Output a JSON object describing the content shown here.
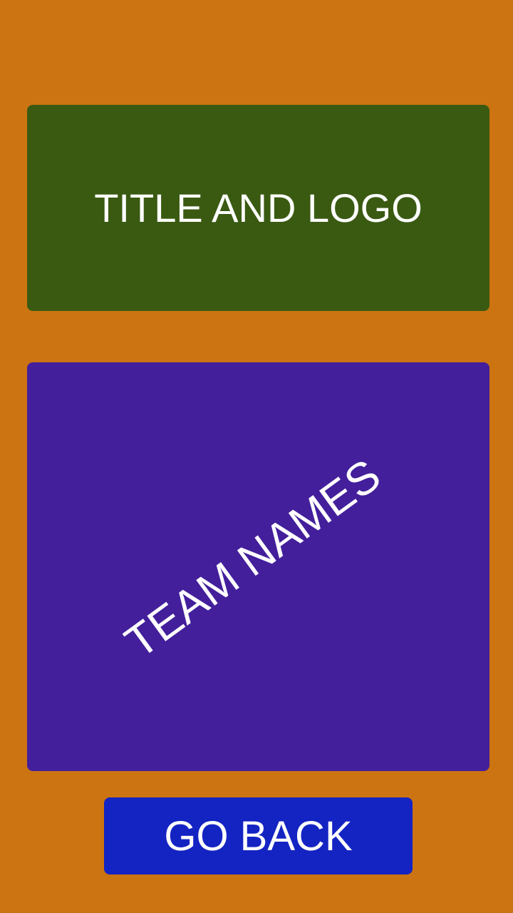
{
  "screen": {
    "background_color": "#cc7412"
  },
  "title_panel": {
    "label": "TITLE AND LOGO",
    "background_color": "#3a5a12"
  },
  "team_panel": {
    "label": "TEAM NAMES",
    "background_color": "#431f9b"
  },
  "actions": {
    "go_back_label": "GO BACK",
    "button_color": "#1424c2"
  }
}
